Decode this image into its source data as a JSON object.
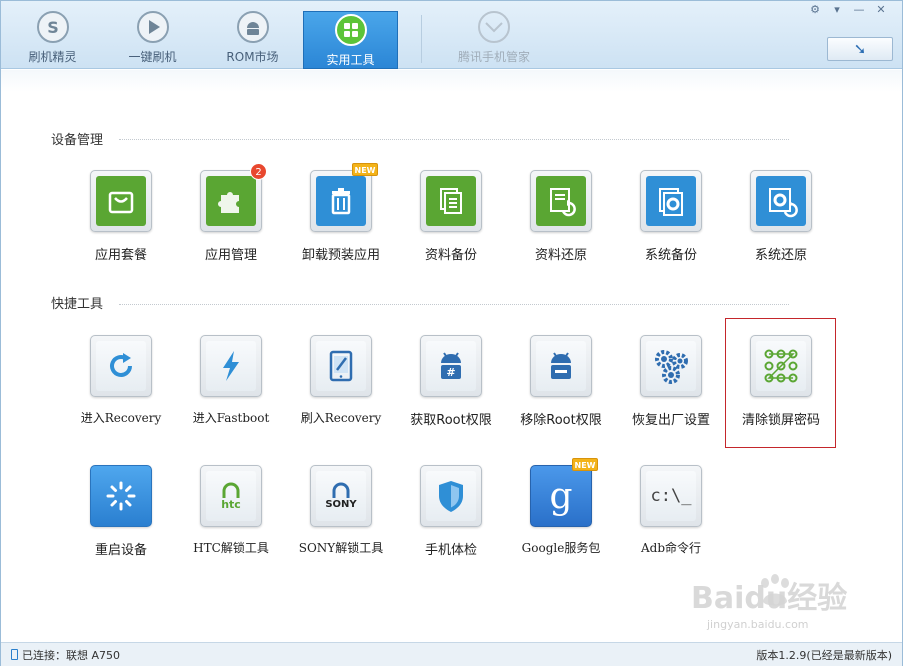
{
  "top_nav": {
    "tabs": [
      {
        "label": "刷机精灵",
        "icon": "shield-s-icon",
        "state": "normal"
      },
      {
        "label": "一键刷机",
        "icon": "play-icon",
        "state": "normal"
      },
      {
        "label": "ROM市场",
        "icon": "android-icon",
        "state": "normal"
      },
      {
        "label": "实用工具",
        "icon": "grid-icon",
        "state": "active"
      },
      {
        "label": "腾讯手机管家",
        "icon": "tencent-shield-icon",
        "state": "disabled"
      }
    ],
    "refresh_icon": "arrow-down-icon"
  },
  "sections": [
    {
      "title": "设备管理",
      "tools": [
        {
          "label": "应用套餐",
          "icon": "shopping-bag-icon",
          "color": "#5aa633"
        },
        {
          "label": "应用管理",
          "icon": "puzzle-icon",
          "color": "#5aa633",
          "badge": "2"
        },
        {
          "label": "卸载预装应用",
          "icon": "trash-icon",
          "color": "#2f8fd6",
          "badge_new": "NEW"
        },
        {
          "label": "资料备份",
          "icon": "documents-icon",
          "color": "#5aa633"
        },
        {
          "label": "资料还原",
          "icon": "document-restore-icon",
          "color": "#5aa633"
        },
        {
          "label": "系统备份",
          "icon": "gear-backup-icon",
          "color": "#2f8fd6"
        },
        {
          "label": "系统还原",
          "icon": "gear-restore-icon",
          "color": "#2f8fd6"
        }
      ]
    },
    {
      "title": "快捷工具",
      "tools": [
        {
          "label": "进入Recovery",
          "icon": "refresh-icon",
          "color": "#2f8fd6"
        },
        {
          "label": "进入Fastboot",
          "icon": "lightning-icon",
          "color": "#2f8fd6"
        },
        {
          "label": "刷入Recovery",
          "icon": "tablet-edit-icon",
          "color": "#2f8fd6"
        },
        {
          "label": "获取Root权限",
          "icon": "android-root-icon",
          "color": "#2f8fd6"
        },
        {
          "label": "移除Root权限",
          "icon": "android-unroot-icon",
          "color": "#2f8fd6"
        },
        {
          "label": "恢复出厂设置",
          "icon": "gears-icon",
          "color": "#2f8fd6"
        },
        {
          "label": "清除锁屏密码",
          "icon": "pattern-lock-icon",
          "color": "#5aa633"
        }
      ]
    },
    {
      "tools": [
        {
          "label": "重启设备",
          "icon": "loading-spinner-icon",
          "color": "#3a95e0"
        },
        {
          "label": "HTC解锁工具",
          "icon": "htc-lock-icon",
          "color": "#5aa633",
          "brand": "htc"
        },
        {
          "label": "SONY解锁工具",
          "icon": "sony-lock-icon",
          "color": "#2f6db0",
          "brand": "SONY"
        },
        {
          "label": "手机体检",
          "icon": "shield-check-icon",
          "color": "#2f8fd6"
        },
        {
          "label": "Google服务包",
          "icon": "google-g-icon",
          "color": "#3a82d8",
          "badge_new": "NEW"
        },
        {
          "label": "Adb命令行",
          "icon": "terminal-icon",
          "color": "#555555",
          "terminal_text": "c:\\_"
        }
      ]
    }
  ],
  "status": {
    "left": "已连接：联想 A750",
    "right": "版本1.2.9(已经是最新版本)"
  },
  "watermark": {
    "text": "Baidu经验",
    "url": "jingyan.baidu.com"
  }
}
